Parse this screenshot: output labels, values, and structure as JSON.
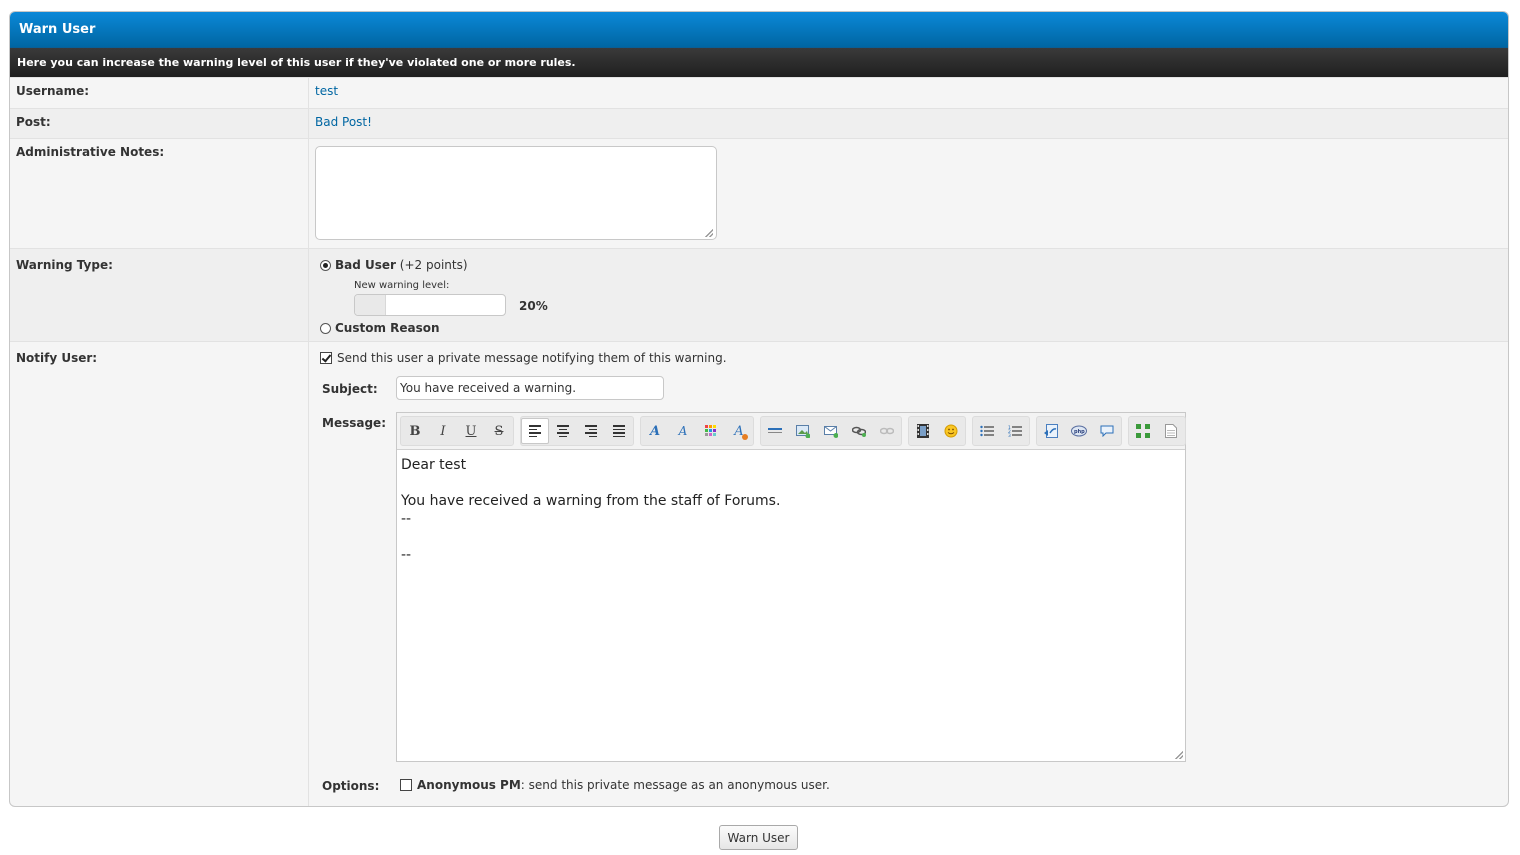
{
  "header": {
    "title": "Warn User",
    "description": "Here you can increase the warning level of this user if they've violated one or more rules."
  },
  "username": {
    "label": "Username:",
    "value": "test"
  },
  "post": {
    "label": "Post:",
    "value": "Bad Post!"
  },
  "notes": {
    "label": "Administrative Notes:",
    "value": ""
  },
  "warning_type": {
    "label": "Warning Type:",
    "option1_name": "Bad User",
    "option1_points": "(+2 points)",
    "new_level_label": "New warning level:",
    "new_level_value": "20%",
    "new_level_fraction": 0.2,
    "option2_name": "Custom Reason"
  },
  "notify": {
    "label": "Notify User:",
    "send_pm_label": "Send this user a private message notifying them of this warning.",
    "subject_label": "Subject:",
    "subject_value": "You have received a warning.",
    "message_label": "Message:",
    "message_text": "Dear test\n\nYou have received a warning from the staff of Forums.\n--\n\n--",
    "options_label": "Options:",
    "anon_bold": "Anonymous PM",
    "anon_text": ": send this private message as an anonymous user."
  },
  "toolbar_icons": [
    "bold-icon",
    "italic-icon",
    "underline-icon",
    "strikethrough-icon",
    "align-left-icon",
    "align-center-icon",
    "align-right-icon",
    "justify-icon",
    "font-icon",
    "font-size-icon",
    "color-icon",
    "remove-format-icon",
    "horizontal-rule-icon",
    "image-icon",
    "email-icon",
    "link-icon",
    "unlink-icon",
    "video-icon",
    "emoticon-icon",
    "bullet-list-icon",
    "ordered-list-icon",
    "code-icon",
    "php-icon",
    "quote-icon",
    "maximize-icon",
    "source-icon"
  ],
  "submit_label": "Warn User"
}
